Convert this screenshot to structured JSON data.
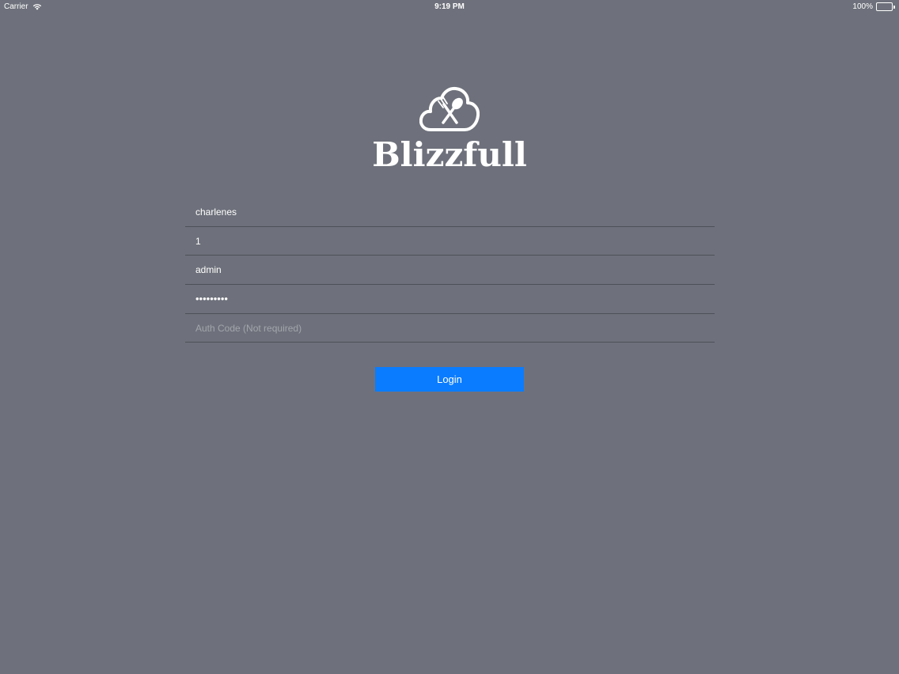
{
  "status_bar": {
    "carrier": "Carrier",
    "time": "9:19 PM",
    "battery": "100%"
  },
  "brand": {
    "name": "Blizzfull",
    "logo_icon": "cloud-fork-spoon-icon"
  },
  "form": {
    "company": {
      "value": "charlenes"
    },
    "store": {
      "value": "1"
    },
    "username": {
      "value": "admin"
    },
    "password": {
      "value": "•••••••••"
    },
    "auth_code": {
      "value": "",
      "placeholder": "Auth Code (Not required)"
    }
  },
  "login_button": {
    "label": "Login",
    "color": "#0a7cff"
  },
  "colors": {
    "background": "#6e717b",
    "divider": "#4d5057"
  }
}
